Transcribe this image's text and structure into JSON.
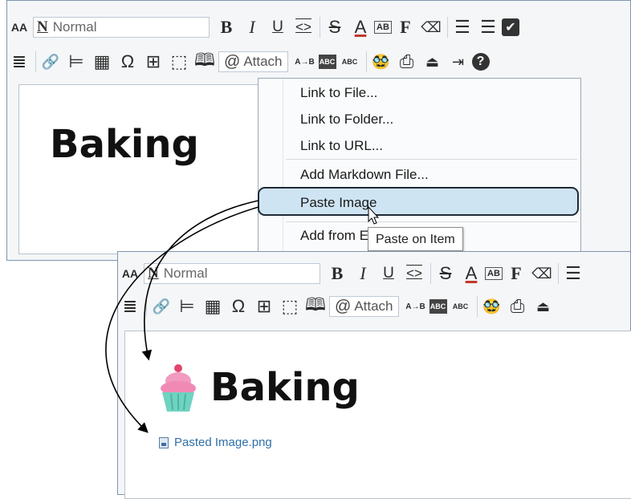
{
  "editor_top": {
    "toolbar": {
      "font_size_icon": "AA",
      "style_select": {
        "icon": "N",
        "value": "Normal"
      },
      "bold": "B",
      "italic": "I",
      "underline": "U",
      "code": "<>",
      "strike": "S",
      "font_color": "A",
      "highlight": "AB",
      "font": "F",
      "bullet_list": "☰",
      "number_list": "☰",
      "checkbox": "✔",
      "align": "≣",
      "link": "🔗",
      "hr": "⊨",
      "table_calc": "▦",
      "omega": "Ω",
      "table": "⊞",
      "frame": "⬚",
      "book": "🕮",
      "attach": "Attach",
      "replace": "A→B",
      "spell_abc": "ABC",
      "spell_check": "ABC",
      "disguise": "🥸",
      "print": "⎙",
      "present": "⏏",
      "collapse": "⇥",
      "help": "?"
    },
    "heading": "Baking"
  },
  "attach_menu": {
    "items": [
      {
        "label": "Link to File..."
      },
      {
        "label": "Link to Folder..."
      },
      {
        "label": "Link to URL..."
      },
      {
        "label": "Add Markdown File..."
      },
      {
        "label": "Paste Image"
      },
      {
        "label": "Add from E"
      }
    ],
    "highlighted_index": 4,
    "tooltip": "Paste on Item"
  },
  "editor_bottom": {
    "toolbar": {
      "font_size_icon": "AA",
      "style_select": {
        "icon": "N",
        "value": "Normal"
      },
      "bold": "B",
      "italic": "I",
      "underline": "U",
      "code": "<>",
      "strike": "S",
      "font_color": "A",
      "highlight": "AB",
      "font": "F",
      "bullet_list": "☰",
      "align": "≣",
      "link": "🔗",
      "hr": "⊨",
      "table_calc": "▦",
      "omega": "Ω",
      "table": "⊞",
      "frame": "⬚",
      "book": "🕮",
      "attach": "Attach",
      "replace": "A→B",
      "spell_abc": "ABC",
      "spell_check": "ABC",
      "disguise": "🥸",
      "print": "⎙",
      "present": "⏏"
    },
    "heading_icon": "cupcake-icon",
    "heading": "Baking",
    "attachment": "Pasted Image.png"
  },
  "colors": {
    "frame_border": "#7f96ad",
    "toolbar_bg": "#f4f6f8",
    "menu_highlight": "#cfe4f3",
    "link_color": "#2f6fa8",
    "cupcake_frosting": "#f08ab4",
    "cupcake_wrapper": "#6fd3c1"
  }
}
